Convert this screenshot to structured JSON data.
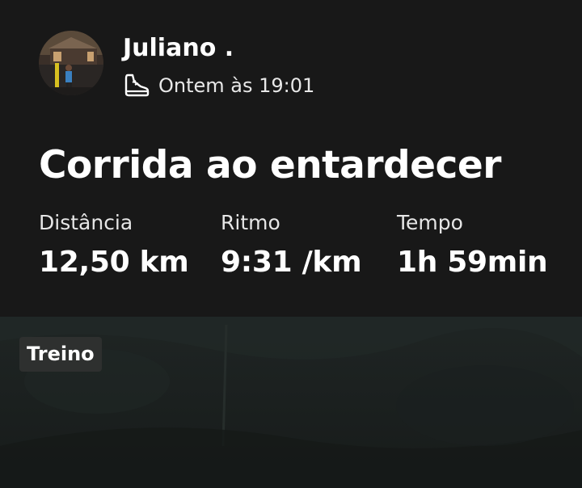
{
  "athlete": {
    "name": "Juliano .",
    "avatar_icon": "athlete-photo"
  },
  "activity": {
    "sport_icon": "running-shoe-icon",
    "timestamp": "Ontem às 19:01",
    "title": "Corrida ao entardecer",
    "stats": {
      "distance": {
        "label": "Distância",
        "value": "12,50 km"
      },
      "pace": {
        "label": "Ritmo",
        "value": "9:31 /km"
      },
      "time": {
        "label": "Tempo",
        "value": "1h 59min"
      }
    }
  },
  "photo": {
    "tag": "Treino"
  },
  "colors": {
    "background": "#181818",
    "text": "#ffffff",
    "photo_dark": "#1c2120",
    "tag_bg": "#2e302f"
  }
}
